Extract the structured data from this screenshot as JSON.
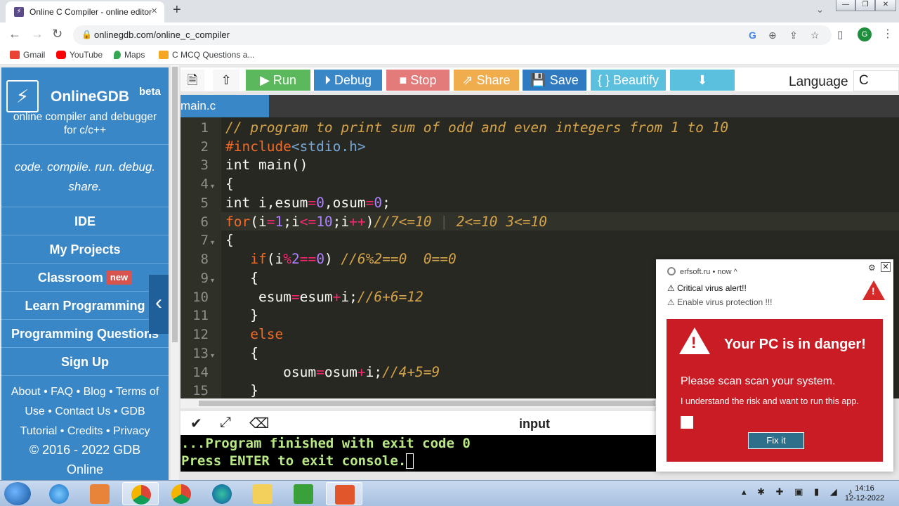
{
  "browser": {
    "tab_title": "Online C Compiler - online editor",
    "url": "onlinegdb.com/online_c_compiler",
    "profile_initial": "G",
    "bookmarks": [
      "Gmail",
      "YouTube",
      "Maps",
      "C MCQ Questions a..."
    ]
  },
  "sidebar": {
    "brand": "OnlineGDB",
    "beta": "beta",
    "tagline_1": "online compiler and debugger",
    "tagline_2": "for c/c++",
    "motto_1": "code. compile. run. debug.",
    "motto_2": "share.",
    "nav": [
      "IDE",
      "My Projects",
      "Classroom",
      "Learn Programming",
      "Programming Questions",
      "Sign Up"
    ],
    "new_badge": "new",
    "footer_line1": "About • FAQ • Blog • Terms of",
    "footer_line2": "Use • Contact Us • GDB",
    "footer_line3": "Tutorial • Credits • Privacy",
    "copyright_1": "© 2016 - 2022 GDB",
    "copyright_2": "Online"
  },
  "ide": {
    "buttons": {
      "run": "Run",
      "debug": "Debug",
      "stop": "Stop",
      "share": "Share",
      "save": "Save",
      "beautify": "{ } Beautify"
    },
    "button_colors": {
      "run": "#5cb85c",
      "debug": "#3a87c8",
      "stop": "#e37b7b",
      "share": "#f0ad4e",
      "save": "#2f7ac1",
      "beautify": "#5bc0de",
      "download": "#5bc0de"
    },
    "language_label": "Language",
    "language_value": "C",
    "file_tab": "main.c",
    "line_numbers": [
      "1",
      "2",
      "3",
      "4",
      "5",
      "6",
      "7",
      "8",
      "9",
      "10",
      "11",
      "12",
      "13",
      "14",
      "15"
    ],
    "console_title": "input",
    "console_lines": [
      "...Program finished with exit code 0",
      "Press ENTER to exit console."
    ]
  },
  "notification": {
    "source": "erfsoft.ru",
    "time": "• now ^",
    "line1": "⚠ Critical virus alert!!",
    "line2": "⚠ Enable virus protection !!!",
    "heading": "Your PC is in danger!",
    "message": "Please scan scan your system.",
    "subtext": "I understand the risk and want to run this app.",
    "button": "Fix it"
  },
  "taskbar": {
    "time": "14:16",
    "date": "12-12-2022"
  }
}
